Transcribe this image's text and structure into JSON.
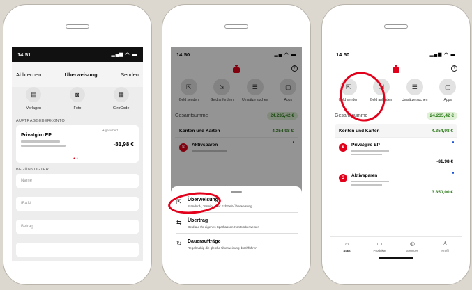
{
  "phone1": {
    "status": {
      "time": "14:51",
      "icons": "▂▄▆ ◠ ▬"
    },
    "header": {
      "left": "Abbrechen",
      "center": "Überweisung",
      "right": "Senden"
    },
    "quick": [
      {
        "icon": "document-icon",
        "glyph": "▤",
        "label": "Vorlagen"
      },
      {
        "icon": "camera-icon",
        "glyph": "◙",
        "label": "Foto"
      },
      {
        "icon": "qr-code-icon",
        "glyph": "▦",
        "label": "GiroCode"
      }
    ],
    "payer_section": "AUFTRAGGEBERKONTO",
    "account": {
      "name": "Privatgiro EP",
      "amount": "-81,98 €",
      "saved": "⇄ gesichert"
    },
    "dots": {
      "active": "●",
      "inactive": "●"
    },
    "payee_section": "BEGÜNSTIGTER",
    "fields": {
      "name": "Name",
      "iban": "IBAN",
      "amount": "Betrag"
    }
  },
  "home": {
    "help": "?",
    "actions": [
      {
        "icon": "send-money-icon",
        "glyph": "⇱",
        "label": "Geld senden"
      },
      {
        "icon": "request-money-icon",
        "glyph": "⇲",
        "label": "Geld anfordern"
      },
      {
        "icon": "transactions-search-icon",
        "glyph": "☰",
        "label": "Umsätze suchen"
      },
      {
        "icon": "apps-icon",
        "glyph": "▢",
        "label": "Apps"
      }
    ],
    "total_label": "Gesamtsumme",
    "total_value": "24.235,42 €",
    "accounts_header": "Konten und Karten",
    "accounts_total": "4.354,98 €",
    "accounts": [
      {
        "name": "Privatgiro EP",
        "value": "-81,98 €"
      },
      {
        "name": "Aktivsparen",
        "value": "3.850,00 €"
      }
    ]
  },
  "phone2": {
    "status": {
      "time": "14:50",
      "icons": "▂▄ ◠ ▬"
    },
    "sheet": [
      {
        "icon": "transfer-icon",
        "glyph": "⇱",
        "title": "Überweisung",
        "sub": "Standard-, Termin- oder Echtzeit-Überweisung"
      },
      {
        "icon": "internal-transfer-icon",
        "glyph": "⇆",
        "title": "Übertrag",
        "sub": "Geld auf Ihr eigenes Sparkassen-Konto überweisen"
      },
      {
        "icon": "standing-order-icon",
        "glyph": "↻",
        "title": "Daueraufträge",
        "sub": "Regelmäßig die gleiche Überweisung durchführen"
      }
    ]
  },
  "phone3": {
    "status": {
      "time": "14:50",
      "icons": "▂▄▆ ◠ ▬"
    },
    "tabs": [
      {
        "icon": "home-icon",
        "glyph": "⌂",
        "label": "Start"
      },
      {
        "icon": "products-icon",
        "glyph": "▭",
        "label": "Produkte"
      },
      {
        "icon": "services-icon",
        "glyph": "◎",
        "label": "Services"
      },
      {
        "icon": "profile-icon",
        "glyph": "♙",
        "label": "Profil"
      }
    ]
  },
  "colors": {
    "brand": "#e2001a",
    "positive": "#2e7d1c",
    "accent_dot": "#1a56d6"
  }
}
